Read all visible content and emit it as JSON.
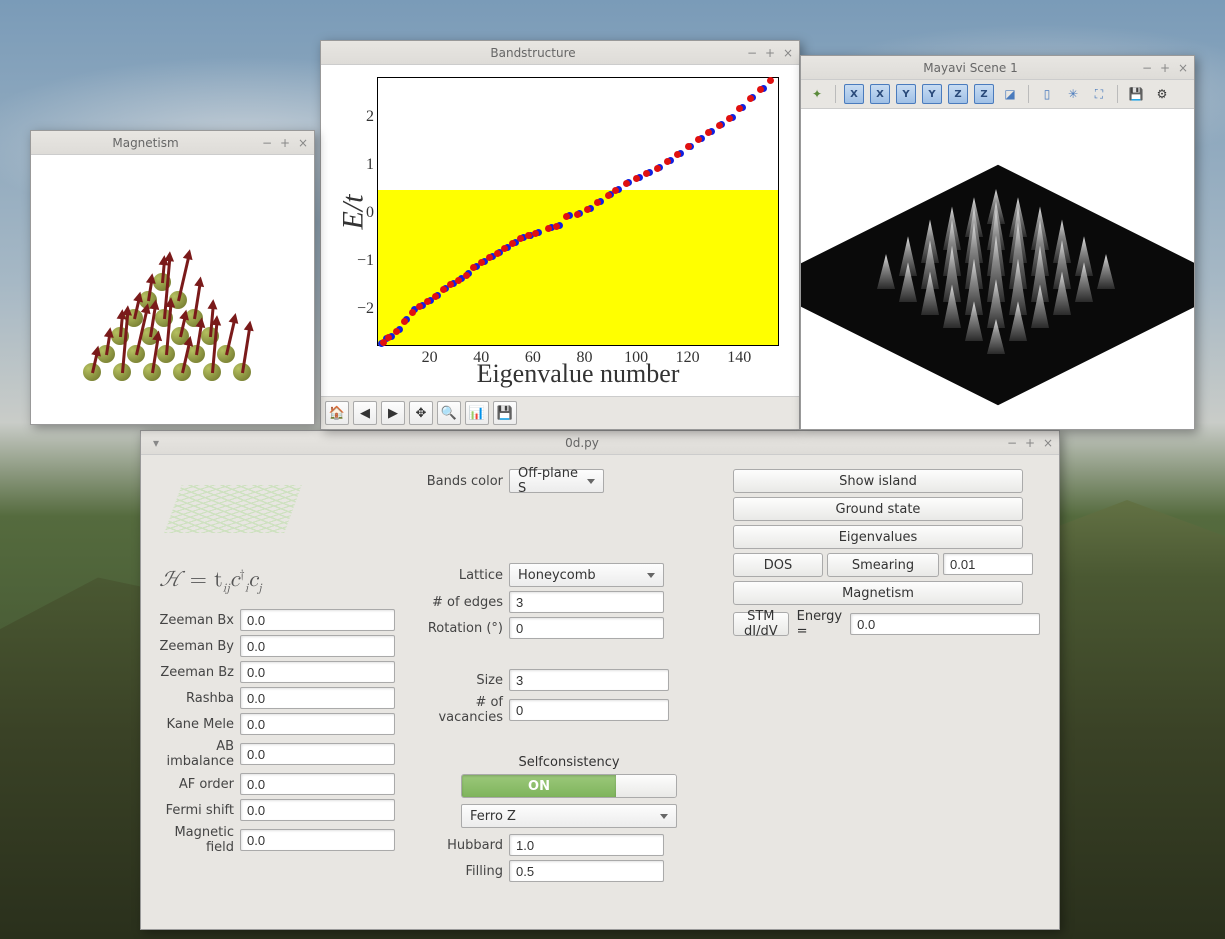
{
  "windows": {
    "main": {
      "title": "0d.py",
      "bands_color_label": "Bands color",
      "bands_color_value": "Off-plane S",
      "lattice_label": "Lattice",
      "lattice_value": "Honeycomb",
      "nedges_label": "# of edges",
      "nedges_value": "3",
      "rotation_label": "Rotation (°)",
      "rotation_value": "0",
      "size_label": "Size",
      "size_value": "3",
      "nvac_label": "# of vacancies",
      "nvac_value": "0",
      "selfcons_label": "Selfconsistency",
      "toggle_on": "ON",
      "magmode_value": "Ferro Z",
      "hubbard_label": "Hubbard",
      "hubbard_value": "1.0",
      "filling_label": "Filling",
      "filling_value": "0.5",
      "equation_h": "ℋ",
      "equation_eq": "= t",
      "equation_sub1": "ij",
      "equation_c1": "c",
      "equation_dag": "†",
      "equation_sub_i": "i",
      "equation_c2": "c",
      "equation_sub_j": "j",
      "zbx_label": "Zeeman Bx",
      "zbx_value": "0.0",
      "zby_label": "Zeeman By",
      "zby_value": "0.0",
      "zbz_label": "Zeeman Bz",
      "zbz_value": "0.0",
      "rashba_label": "Rashba",
      "rashba_value": "0.0",
      "kane_label": "Kane Mele",
      "kane_value": "0.0",
      "ab_label": "AB imbalance",
      "ab_value": "0.0",
      "af_label": "AF order",
      "af_value": "0.0",
      "fermi_label": "Fermi shift",
      "fermi_value": "0.0",
      "magf_label": "Magnetic field",
      "magf_value": "0.0",
      "btn_show": "Show island",
      "btn_ground": "Ground state",
      "btn_eigen": "Eigenvalues",
      "btn_dos": "DOS",
      "smearing_label": "Smearing",
      "smearing_value": "0.01",
      "btn_mag": "Magnetism",
      "btn_stm": "STM dI/dV",
      "energy_label": "Energy =",
      "energy_value": "0.0"
    },
    "band": {
      "title": "Bandstructure"
    },
    "magnetism": {
      "title": "Magnetism"
    },
    "mayavi": {
      "title": "Mayavi Scene 1",
      "ax_x1": "X",
      "ax_x2": "X",
      "ax_y1": "Y",
      "ax_y2": "Y",
      "ax_z1": "Z",
      "ax_z2": "Z"
    }
  },
  "chart_data": {
    "type": "scatter",
    "title": "",
    "xlabel": "Eigenvalue number",
    "ylabel": "E/t",
    "xlim": [
      0,
      155
    ],
    "ylim": [
      -2.8,
      2.8
    ],
    "xticks": [
      20,
      40,
      60,
      80,
      100,
      120,
      140
    ],
    "yticks": [
      -2,
      -1,
      0,
      1,
      2
    ],
    "series": [
      {
        "name": "blue",
        "color": "#1020e0",
        "values": [
          [
            1,
            -2.7
          ],
          [
            3,
            -2.6
          ],
          [
            5,
            -2.55
          ],
          [
            8,
            -2.4
          ],
          [
            11,
            -2.2
          ],
          [
            14,
            -2.0
          ],
          [
            17,
            -1.9
          ],
          [
            20,
            -1.8
          ],
          [
            23,
            -1.7
          ],
          [
            26,
            -1.55
          ],
          [
            29,
            -1.45
          ],
          [
            32,
            -1.35
          ],
          [
            35,
            -1.25
          ],
          [
            38,
            -1.1
          ],
          [
            41,
            -1.0
          ],
          [
            44,
            -0.9
          ],
          [
            47,
            -0.8
          ],
          [
            50,
            -0.7
          ],
          [
            53,
            -0.6
          ],
          [
            56,
            -0.5
          ],
          [
            59,
            -0.45
          ],
          [
            62,
            -0.4
          ],
          [
            67,
            -0.3
          ],
          [
            70,
            -0.25
          ],
          [
            74,
            -0.05
          ],
          [
            78,
            0.0
          ],
          [
            82,
            0.1
          ],
          [
            86,
            0.25
          ],
          [
            90,
            0.4
          ],
          [
            93,
            0.5
          ],
          [
            97,
            0.65
          ],
          [
            101,
            0.75
          ],
          [
            105,
            0.85
          ],
          [
            109,
            0.95
          ],
          [
            113,
            1.1
          ],
          [
            117,
            1.25
          ],
          [
            121,
            1.4
          ],
          [
            125,
            1.55
          ],
          [
            129,
            1.7
          ],
          [
            133,
            1.85
          ],
          [
            137,
            2.0
          ],
          [
            141,
            2.2
          ],
          [
            145,
            2.4
          ],
          [
            149,
            2.6
          ]
        ]
      },
      {
        "name": "red",
        "color": "#e01010",
        "values": [
          [
            2,
            -2.68
          ],
          [
            4,
            -2.58
          ],
          [
            7,
            -2.45
          ],
          [
            10,
            -2.25
          ],
          [
            13,
            -2.05
          ],
          [
            16,
            -1.92
          ],
          [
            19,
            -1.82
          ],
          [
            22,
            -1.72
          ],
          [
            25,
            -1.58
          ],
          [
            28,
            -1.48
          ],
          [
            31,
            -1.38
          ],
          [
            34,
            -1.28
          ],
          [
            37,
            -1.12
          ],
          [
            40,
            -1.02
          ],
          [
            43,
            -0.92
          ],
          [
            46,
            -0.82
          ],
          [
            49,
            -0.72
          ],
          [
            52,
            -0.62
          ],
          [
            55,
            -0.52
          ],
          [
            58,
            -0.46
          ],
          [
            61,
            -0.41
          ],
          [
            66,
            -0.31
          ],
          [
            69,
            -0.26
          ],
          [
            73,
            -0.07
          ],
          [
            77,
            -0.02
          ],
          [
            81,
            0.08
          ],
          [
            85,
            0.23
          ],
          [
            89,
            0.38
          ],
          [
            92,
            0.48
          ],
          [
            96,
            0.63
          ],
          [
            100,
            0.73
          ],
          [
            104,
            0.83
          ],
          [
            108,
            0.93
          ],
          [
            112,
            1.08
          ],
          [
            116,
            1.23
          ],
          [
            120,
            1.38
          ],
          [
            124,
            1.53
          ],
          [
            128,
            1.68
          ],
          [
            132,
            1.83
          ],
          [
            136,
            1.98
          ],
          [
            140,
            2.18
          ],
          [
            144,
            2.38
          ],
          [
            148,
            2.58
          ],
          [
            152,
            2.75
          ]
        ]
      }
    ]
  }
}
